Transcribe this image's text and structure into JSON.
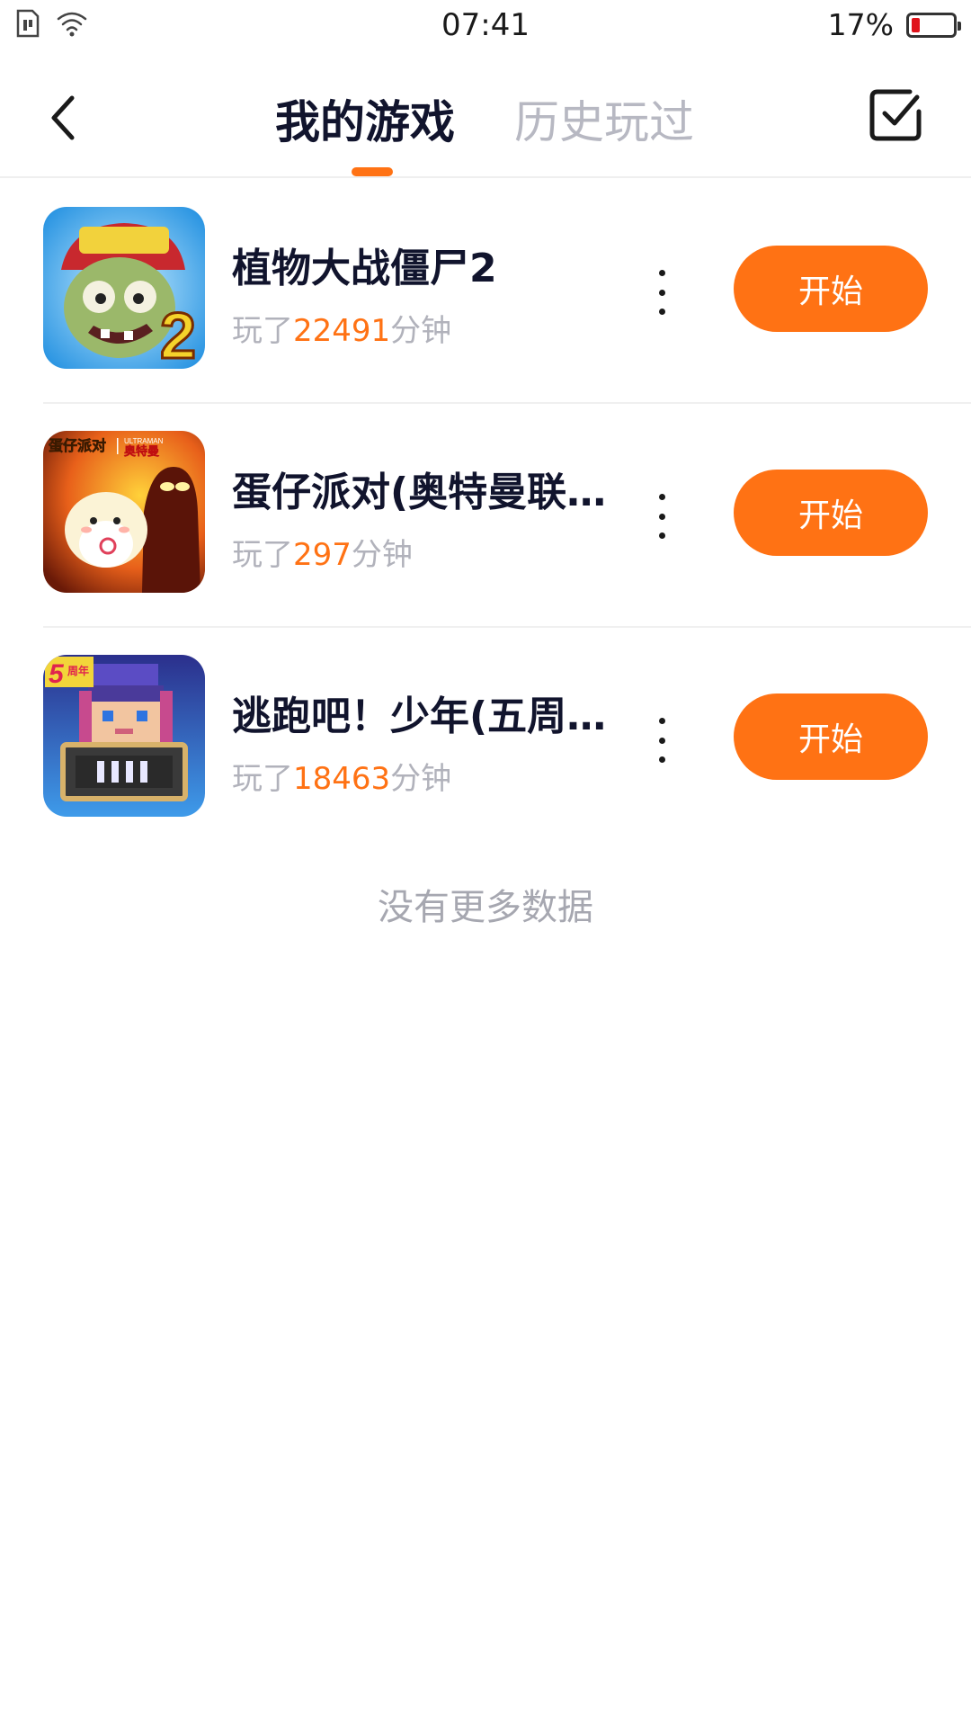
{
  "status_bar": {
    "time": "07:41",
    "battery_percent": "17%",
    "battery_level": 0.17,
    "icons": [
      "sim-icon",
      "wifi-icon",
      "battery-icon"
    ]
  },
  "header": {
    "tabs": [
      {
        "label": "我的游戏",
        "active": true
      },
      {
        "label": "历史玩过",
        "active": false
      }
    ],
    "back_icon": "chevron-left-icon",
    "action_icon": "checkbox-icon"
  },
  "colors": {
    "accent": "#ff7214",
    "title": "#11142d",
    "muted": "#b1b2bb"
  },
  "games": [
    {
      "title": "植物大战僵尸2",
      "played_prefix": "玩了",
      "minutes": "22491",
      "minutes_suffix": "分钟",
      "start_label": "开始",
      "icon_name": "plants-vs-zombies-2-icon"
    },
    {
      "title": "蛋仔派对(奥特曼联…",
      "played_prefix": "玩了",
      "minutes": "297",
      "minutes_suffix": "分钟",
      "start_label": "开始",
      "icon_name": "eggy-party-ultraman-icon",
      "icon_text": [
        "蛋仔派对",
        "ULTRAMAN",
        "奥特曼"
      ]
    },
    {
      "title": "逃跑吧！少年(五周…",
      "played_prefix": "玩了",
      "minutes": "18463",
      "minutes_suffix": "分钟",
      "start_label": "开始",
      "icon_name": "run-boy-5th-anniversary-icon",
      "icon_text": [
        "5",
        "周年"
      ]
    }
  ],
  "footer": {
    "no_more_text": "没有更多数据"
  }
}
